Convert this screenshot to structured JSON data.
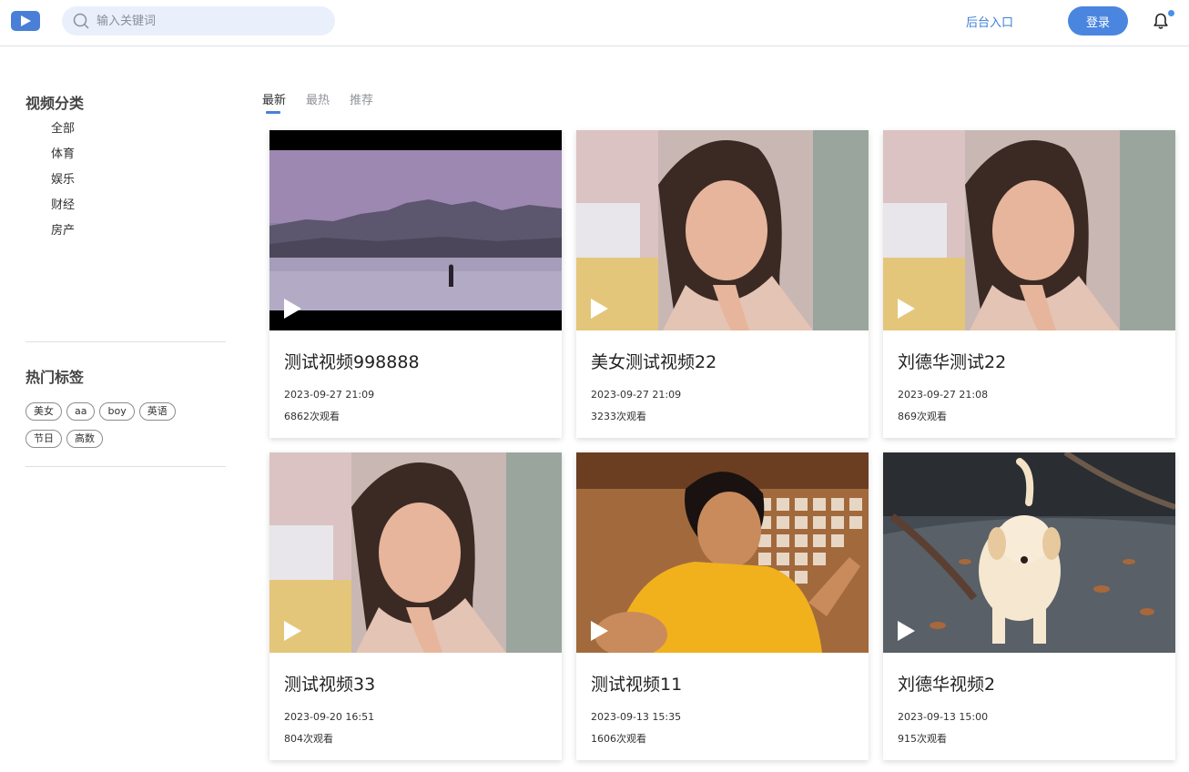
{
  "header": {
    "search_placeholder": "输入关键词",
    "admin_link": "后台入口",
    "login_label": "登录"
  },
  "sidebar": {
    "category_title": "视频分类",
    "categories": [
      "全部",
      "体育",
      "娱乐",
      "财经",
      "房产"
    ],
    "tags_title": "热门标签",
    "tags": [
      "美女",
      "aa",
      "boy",
      "英语",
      "节日",
      "高数"
    ]
  },
  "tabs": [
    "最新",
    "最热",
    "推荐"
  ],
  "active_tab": "最新",
  "videos": [
    {
      "title": "测试视频998888",
      "date": "2023-09-27 21:09",
      "views": "6862次观看",
      "thumbnail": "landscape"
    },
    {
      "title": "美女测试视频22",
      "date": "2023-09-27 21:09",
      "views": "3233次观看",
      "thumbnail": "portrait-woman"
    },
    {
      "title": "刘德华测试22",
      "date": "2023-09-27 21:08",
      "views": "869次观看",
      "thumbnail": "portrait-woman"
    },
    {
      "title": "测试视频33",
      "date": "2023-09-20 16:51",
      "views": "804次观看",
      "thumbnail": "portrait-woman"
    },
    {
      "title": "测试视频11",
      "date": "2023-09-13 15:35",
      "views": "1606次观看",
      "thumbnail": "martial-artist"
    },
    {
      "title": "刘德华视频2",
      "date": "2023-09-13 15:00",
      "views": "915次观看",
      "thumbnail": "puppy"
    }
  ],
  "colors": {
    "accent": "#4a86e0",
    "link": "#3d7fd6",
    "search_bg": "#e9f0fb"
  }
}
